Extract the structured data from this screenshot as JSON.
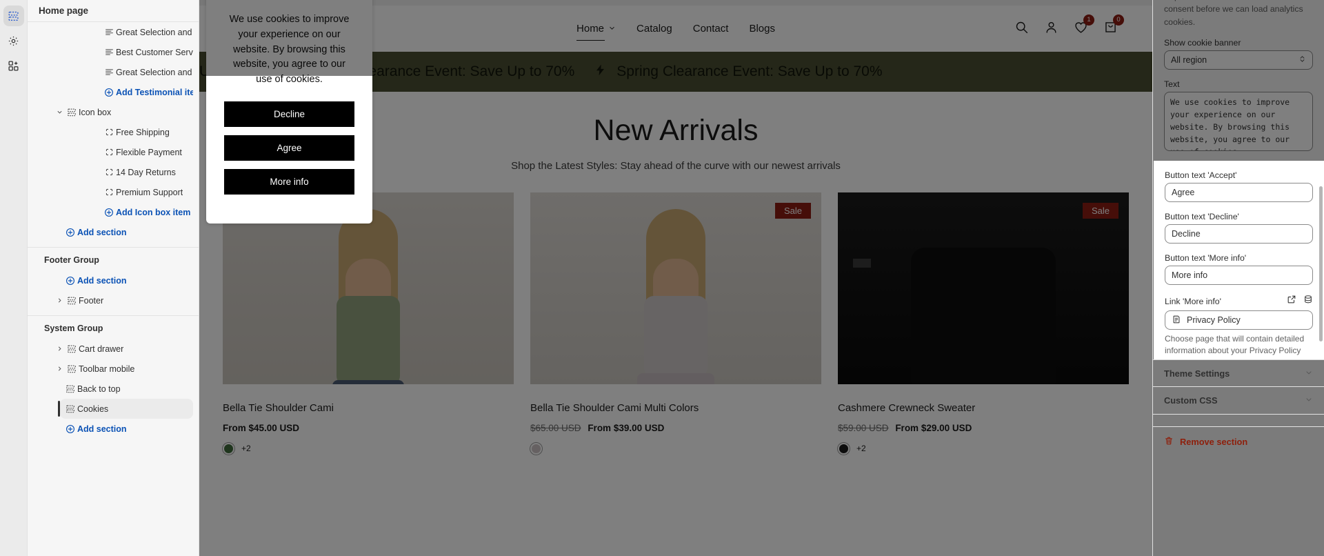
{
  "rail": {
    "items": [
      {
        "name": "sections-icon",
        "label": "Sections"
      },
      {
        "name": "gear-icon",
        "label": "Theme settings"
      },
      {
        "name": "apps-icon",
        "label": "Apps"
      }
    ]
  },
  "sidebar": {
    "title": "Home page",
    "rows": [
      {
        "label": "Great Selection and Quality",
        "icon": "text-lines-icon",
        "kind": "block"
      },
      {
        "label": "Best Customer Service",
        "icon": "text-lines-icon",
        "kind": "block"
      },
      {
        "label": "Great Selection and Quality",
        "icon": "text-lines-icon",
        "kind": "block"
      },
      {
        "label": "Add Testimonial item",
        "icon": "plus-circle-icon",
        "kind": "add"
      },
      {
        "label": "Icon box",
        "icon": "section-icon",
        "kind": "section",
        "expanded": true
      },
      {
        "label": "Free Shipping",
        "icon": "block-icon",
        "kind": "block"
      },
      {
        "label": "Flexible Payment",
        "icon": "block-icon",
        "kind": "block"
      },
      {
        "label": "14 Day Returns",
        "icon": "block-icon",
        "kind": "block"
      },
      {
        "label": "Premium Support",
        "icon": "block-icon",
        "kind": "block"
      },
      {
        "label": "Add Icon box item",
        "icon": "plus-circle-icon",
        "kind": "add"
      },
      {
        "label": "Add section",
        "icon": "plus-circle-icon",
        "kind": "add-section"
      }
    ],
    "footer_group": {
      "title": "Footer Group",
      "add_label": "Add section",
      "items": [
        {
          "label": "Footer",
          "icon": "section-icon"
        }
      ]
    },
    "system_group": {
      "title": "System Group",
      "items": [
        {
          "label": "Cart drawer",
          "icon": "section-icon",
          "collapsible": true
        },
        {
          "label": "Toolbar mobile",
          "icon": "section-icon",
          "collapsible": true
        },
        {
          "label": "Back to top",
          "icon": "section-icon",
          "collapsible": false
        },
        {
          "label": "Cookies",
          "icon": "section-icon",
          "collapsible": false,
          "selected": true
        }
      ],
      "add_label": "Add section"
    }
  },
  "preview": {
    "nav": [
      {
        "label": "Home",
        "active": true,
        "caret": true
      },
      {
        "label": "Catalog",
        "active": false,
        "caret": false
      },
      {
        "label": "Contact",
        "active": false,
        "caret": false
      },
      {
        "label": "Blogs",
        "active": false,
        "caret": false
      }
    ],
    "icons": [
      {
        "name": "search-icon",
        "badge": null
      },
      {
        "name": "account-icon",
        "badge": null
      },
      {
        "name": "wishlist-heart-icon",
        "badge": "1"
      },
      {
        "name": "cart-icon",
        "badge": "0"
      }
    ],
    "marquee": {
      "text": "Spring Clearance Event: Save Up to 70%",
      "partial_text": "Up to 70%",
      "bg": "#4b4f32"
    },
    "heading": "New Arrivals",
    "subheading": "Shop the Latest Styles: Stay ahead of the curve with our newest arrivals",
    "products": [
      {
        "title": "Bella Tie Shoulder Cami",
        "price": "From $45.00 USD",
        "compare_at": null,
        "sale": null,
        "swatch": "#3f6b3a",
        "swatch_more": "+2"
      },
      {
        "title": "Bella Tie Shoulder Cami Multi Colors",
        "price": "From $39.00 USD",
        "compare_at": "$65.00 USD",
        "sale": "Sale",
        "swatch": "#cdc2c4",
        "swatch_more": ""
      },
      {
        "title": "Cashmere Crewneck Sweater",
        "price": "From $29.00 USD",
        "compare_at": "$59.00 USD",
        "sale": "Sale",
        "swatch": "#1a1a1a",
        "swatch_more": "+2"
      }
    ]
  },
  "cookie_banner": {
    "text": "We use cookies to improve your experience on our website. By browsing this website, you agree to our use of cookies.",
    "buttons": [
      {
        "label": "Decline",
        "name": "decline-button"
      },
      {
        "label": "Agree",
        "name": "agree-button"
      },
      {
        "label": "More info",
        "name": "more-info-button"
      }
    ]
  },
  "settings": {
    "help_text": "required to ask customers for their consent before we can load analytics cookies.",
    "show_banner": {
      "label": "Show cookie banner",
      "value": "All region"
    },
    "text_field": {
      "label": "Text",
      "value": "We use cookies to improve your experience on our website. By browsing this website, you agree to our use of cookies."
    },
    "accept_button": {
      "label": "Button text 'Accept'",
      "value": "Agree"
    },
    "decline_button": {
      "label": "Button text 'Decline'",
      "value": "Decline"
    },
    "more_info_button": {
      "label": "Button text 'More info'",
      "value": "More info"
    },
    "more_info_link": {
      "label": "Link 'More info'",
      "value": "Privacy Policy",
      "help": "Choose page that will contain detailed information about your Privacy Policy",
      "icons": [
        "external-link-icon",
        "database-icon"
      ],
      "value_icon": "page-icon"
    },
    "accordions": [
      {
        "label": "Theme Settings",
        "name": "theme-settings"
      },
      {
        "label": "Custom CSS",
        "name": "custom-css"
      }
    ],
    "remove_section": {
      "label": "Remove section",
      "color": "#8e1f0b"
    }
  },
  "colors": {
    "accent_link": "#0b52b5",
    "marquee_bg": "#4b4f32",
    "sale_badge": "#8c1c13",
    "destructive": "#8e1f0b"
  }
}
